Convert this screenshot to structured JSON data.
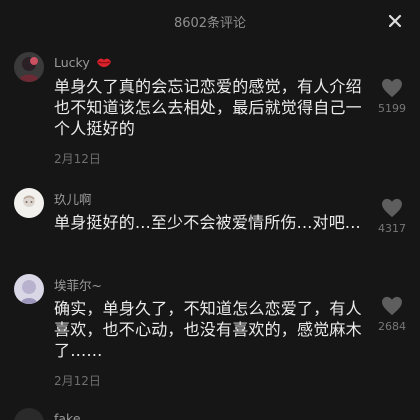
{
  "header": {
    "title": "8602条评论"
  },
  "comments": [
    {
      "username": "Lucky",
      "text": "单身久了真的会忘记恋爱的感觉，有人介绍也不知道该怎么去相处，最后就觉得自己一个人挺好的",
      "date": "2月12日",
      "likes": "5199"
    },
    {
      "username": "玖儿啊",
      "text": "单身挺好的...至少不会被爱情所伤...对吧...",
      "date": "",
      "likes": "4317"
    },
    {
      "username": "埃菲尔~",
      "text": "确实，单身久了，不知道怎么恋爱了，有人喜欢，也不心动，也没有喜欢的，感觉麻木了……",
      "date": "2月12日",
      "likes": "2684"
    },
    {
      "username": "fake",
      "text": "",
      "date": "",
      "likes": ""
    }
  ],
  "icons": {
    "close": "close-icon",
    "like": "heart-icon",
    "badge": "lips-icon"
  },
  "colors": {
    "background": "#161616",
    "badge": "#d8232d"
  }
}
